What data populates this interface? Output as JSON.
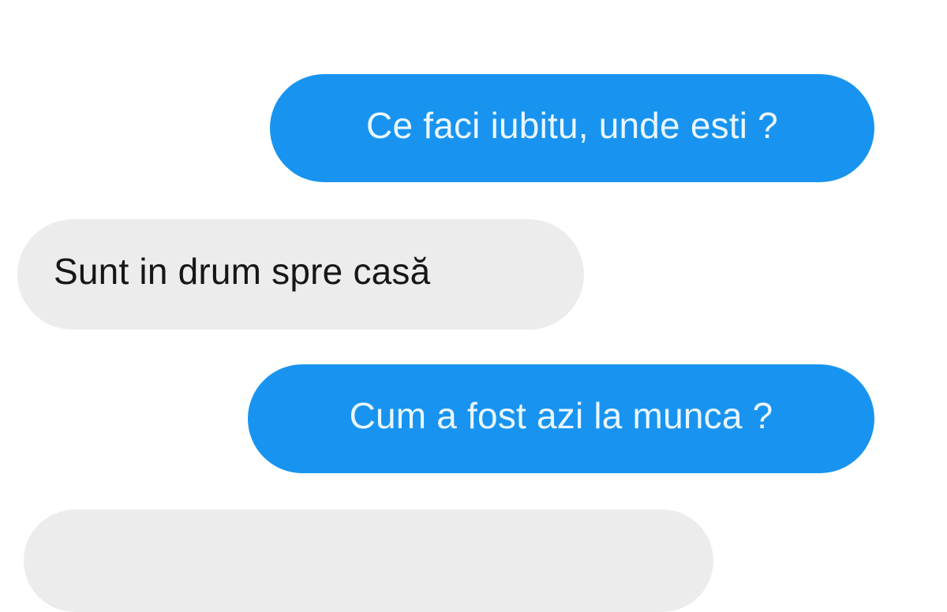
{
  "messages": [
    {
      "direction": "outgoing",
      "text": "Ce faci iubitu, unde esti ?"
    },
    {
      "direction": "incoming",
      "text": "Sunt in drum spre casă"
    },
    {
      "direction": "outgoing",
      "text": "Cum a fost azi la munca ?"
    },
    {
      "direction": "incoming",
      "text": ""
    }
  ],
  "colors": {
    "outgoing_bubble": "#1894f0",
    "outgoing_text": "#eaf6ff",
    "incoming_bubble": "#ececec",
    "incoming_text": "#161616",
    "background": "#ffffff"
  }
}
